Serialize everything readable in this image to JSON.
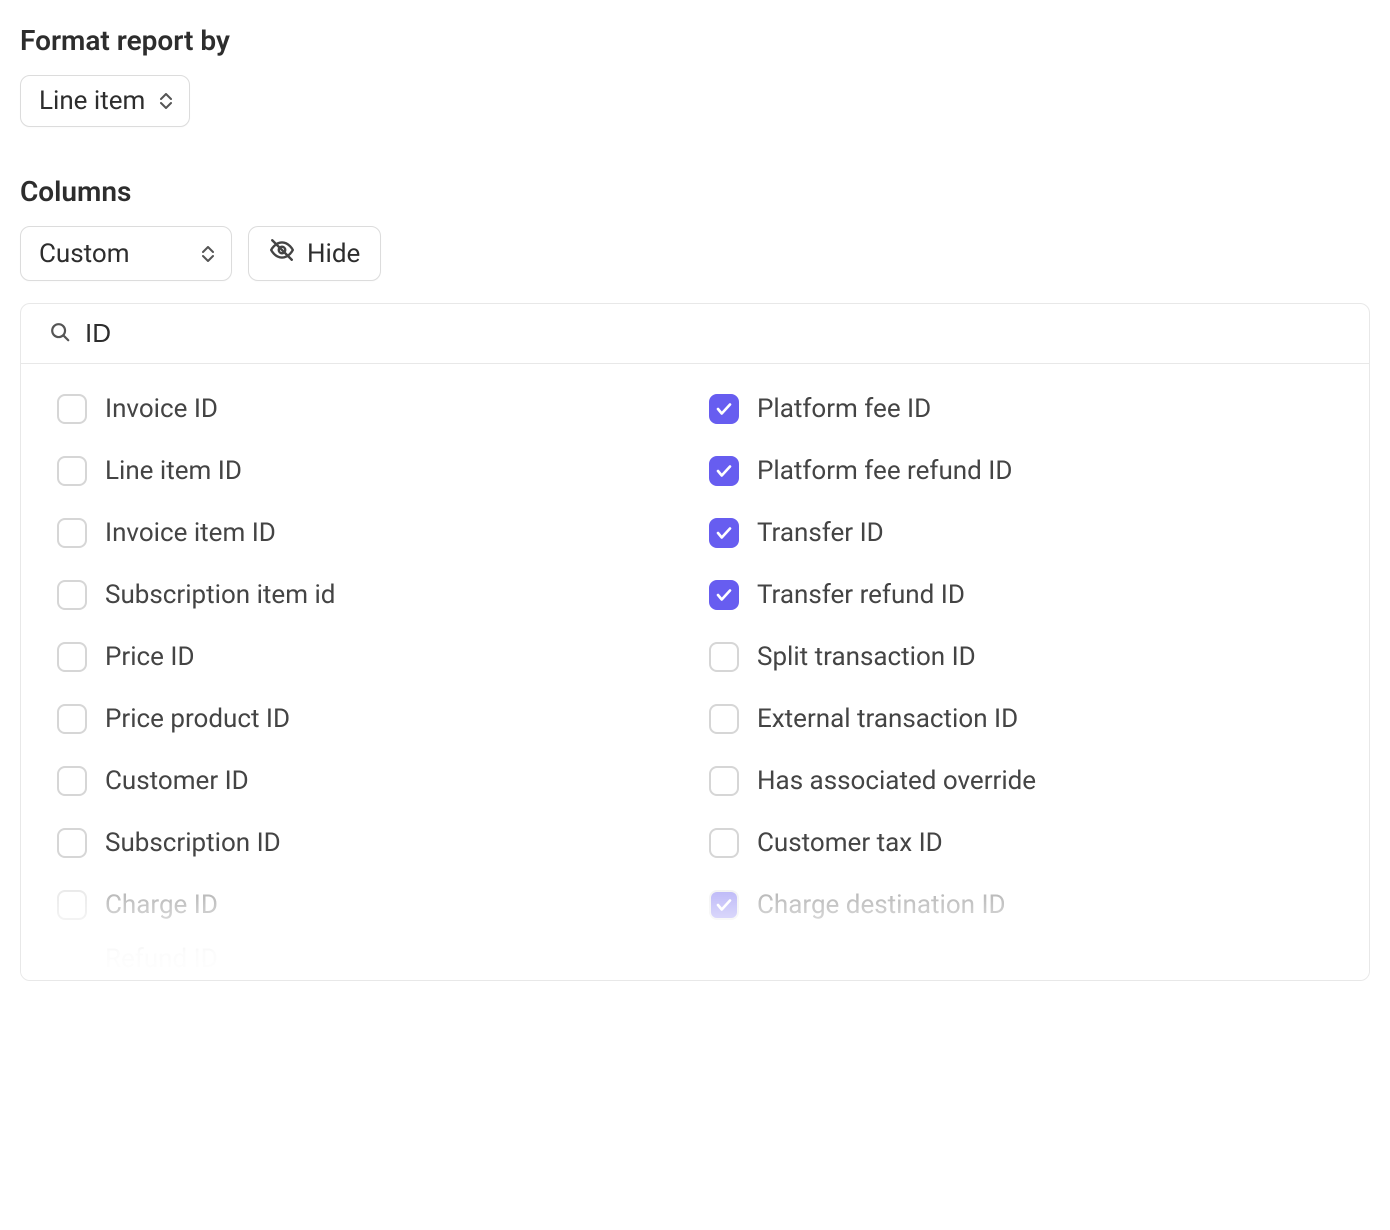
{
  "format_report": {
    "label": "Format report by",
    "selected": "Line item"
  },
  "columns": {
    "label": "Columns",
    "preset_selected": "Custom",
    "hide_button_label": "Hide",
    "search_value": "ID",
    "partial_item": "Refund ID",
    "options_left": [
      {
        "label": "Invoice ID",
        "checked": false,
        "faded": false
      },
      {
        "label": "Line item ID",
        "checked": false,
        "faded": false
      },
      {
        "label": "Invoice item ID",
        "checked": false,
        "faded": false
      },
      {
        "label": "Subscription item id",
        "checked": false,
        "faded": false
      },
      {
        "label": "Price ID",
        "checked": false,
        "faded": false
      },
      {
        "label": "Price product ID",
        "checked": false,
        "faded": false
      },
      {
        "label": "Customer ID",
        "checked": false,
        "faded": false
      },
      {
        "label": "Subscription ID",
        "checked": false,
        "faded": false
      },
      {
        "label": "Charge ID",
        "checked": false,
        "faded": true
      }
    ],
    "options_right": [
      {
        "label": "Platform fee ID",
        "checked": true,
        "faded": false
      },
      {
        "label": "Platform fee refund ID",
        "checked": true,
        "faded": false
      },
      {
        "label": "Transfer ID",
        "checked": true,
        "faded": false
      },
      {
        "label": "Transfer refund ID",
        "checked": true,
        "faded": false
      },
      {
        "label": "Split transaction ID",
        "checked": false,
        "faded": false
      },
      {
        "label": "External transaction ID",
        "checked": false,
        "faded": false
      },
      {
        "label": "Has associated override",
        "checked": false,
        "faded": false
      },
      {
        "label": "Customer tax ID",
        "checked": false,
        "faded": false
      },
      {
        "label": "Charge destination ID",
        "checked": true,
        "faded": true
      }
    ]
  }
}
